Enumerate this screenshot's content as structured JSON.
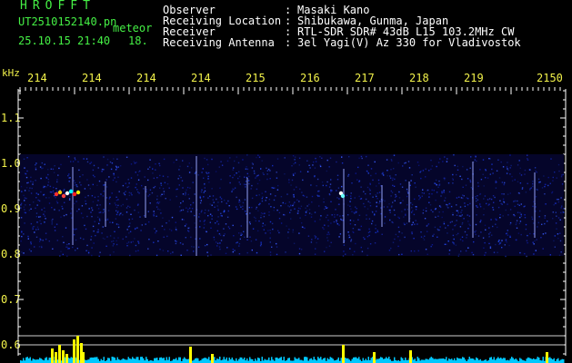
{
  "brand": {
    "name": "HROFFT"
  },
  "file": {
    "filename": "UT2510152140.pn",
    "mode": "meteor",
    "datetime": "25.10.15 21:40",
    "count": "18."
  },
  "header": {
    "rows": [
      {
        "label": "Observer",
        "value": "Masaki Kano"
      },
      {
        "label": "Receiving Location",
        "value": "Shibukawa, Gunma, Japan"
      },
      {
        "label": "Receiver",
        "value": "RTL-SDR SDR# 43dB L15 103.2MHz CW"
      },
      {
        "label": "Receiving Antenna",
        "value": "3el Yagi(V) Az 330 for Vladivostok"
      }
    ]
  },
  "axis": {
    "unit": "kHz",
    "freq_ticks": [
      "214",
      "214",
      "214",
      "214",
      "215",
      "216",
      "217",
      "218",
      "219",
      "2150"
    ],
    "y_ticks": [
      "1.1",
      "1.0",
      "0.9",
      "0.8",
      "0.7",
      "0.6"
    ]
  },
  "colors": {
    "text_green": "#45f045",
    "text_yellow": "#f2f24a",
    "signal_cyan": "#00c8ff",
    "spike_yellow": "#ffff00"
  }
}
